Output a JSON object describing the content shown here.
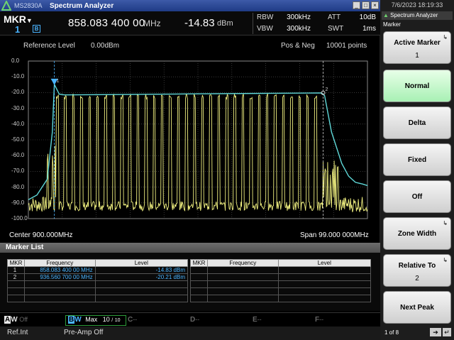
{
  "title_bar": {
    "model": "MS2830A",
    "app": "Spectrum Analyzer"
  },
  "header": {
    "mkr_label": "MKR",
    "mkr_number": "1",
    "mkr_badge": "B",
    "frequency": "858.083 400 00",
    "frequency_unit": "MHz",
    "level": "-14.83",
    "level_unit": "dBm",
    "rbw_label": "RBW",
    "rbw_value": "300kHz",
    "vbw_label": "VBW",
    "vbw_value": "300kHz",
    "att_label": "ATT",
    "att_value": "10dB",
    "swt_label": "SWT",
    "swt_value": "1ms"
  },
  "trace": {
    "reference_level_label": "Reference Level",
    "reference_level_value": "0.00dBm",
    "detection": "Pos & Neg",
    "points": "10001 points",
    "center": "Center 900.000MHz",
    "span": "Span 99.000 000MHz",
    "y_ticks": [
      "0.0",
      "-10.0",
      "-20.0",
      "-30.0",
      "-40.0",
      "-50.0",
      "-60.0",
      "-70.0",
      "-80.0",
      "-90.0",
      "-100.0"
    ],
    "marker1_label": "1",
    "marker2_label": "2",
    "colors": {
      "trace_b": "#f0f080",
      "trace_a": "#5fd8d8",
      "grid": "#5a5a5a",
      "marker": "#4ab4ff"
    }
  },
  "chart_data": {
    "type": "line",
    "title": "",
    "xlabel": "",
    "ylabel": "",
    "x_center_mhz": 900.0,
    "x_span_mhz": 99.0,
    "xlim_mhz": [
      850.5,
      949.5
    ],
    "ylim": [
      -100.0,
      0.0
    ],
    "y_unit": "dBm",
    "grid": true,
    "series": [
      {
        "color": "#5fd8d8",
        "x": [
          850.5,
          853.0,
          856.0,
          857.5,
          858.08,
          859.5,
          861.0,
          880.0,
          900.0,
          920.0,
          936.0,
          937.0,
          939.0,
          942.0,
          944.0,
          946.0,
          948.0,
          949.5
        ],
        "y": [
          -88,
          -85,
          -75,
          -45,
          -14.83,
          -21,
          -21.5,
          -21.2,
          -20.8,
          -20.5,
          -20.21,
          -22,
          -45,
          -65,
          -73,
          -77,
          -78,
          -79
        ]
      },
      {
        "color": "#f0f080",
        "channel_peaks_dbm": -21,
        "channel_floor_dbm": -95,
        "noise_floor_dbm": -91
      }
    ],
    "markers": [
      {
        "name": "1",
        "frequency_mhz": 858.0834,
        "level_dbm": -14.83
      },
      {
        "name": "2",
        "frequency_mhz": 936.5607,
        "level_dbm": -20.21
      }
    ]
  },
  "marker_list": {
    "title": "Marker List",
    "headers": [
      "MKR",
      "Frequency",
      "Level"
    ],
    "rows": [
      {
        "mkr": "1",
        "frequency": "858.083 400 00 MHz",
        "level": "-14.83 dBm"
      },
      {
        "mkr": "2",
        "frequency": "936.560 700 00 MHz",
        "level": "-20.21 dBm"
      }
    ]
  },
  "trace_status": {
    "a_letter": "A",
    "a_state": "W",
    "a_mode": "Off",
    "b_letter": "B",
    "b_state": "W",
    "b_mode": "Max",
    "b_count": "10",
    "b_slash": "/",
    "b_total": "10",
    "c_letter": "C",
    "c_mode": "--",
    "d_letter": "D",
    "d_mode": "--",
    "e_letter": "E",
    "e_mode": "--",
    "f_letter": "F",
    "f_mode": "--"
  },
  "status_bar": {
    "ref": "Ref.Int",
    "preamp": "Pre-Amp Off"
  },
  "side_panel": {
    "clock": "7/6/2023 18:19:33",
    "title": "Spectrum Analyzer",
    "subtitle": "Marker",
    "buttons": [
      {
        "label": "Active Marker",
        "value": "1"
      },
      {
        "label": "Normal",
        "value": ""
      },
      {
        "label": "Delta",
        "value": ""
      },
      {
        "label": "Fixed",
        "value": ""
      },
      {
        "label": "Off",
        "value": ""
      },
      {
        "label": "Zone Width",
        "value": ""
      },
      {
        "label": "Relative To",
        "value": "2"
      },
      {
        "label": "Next Peak",
        "value": ""
      }
    ],
    "page": "1 of 8"
  }
}
